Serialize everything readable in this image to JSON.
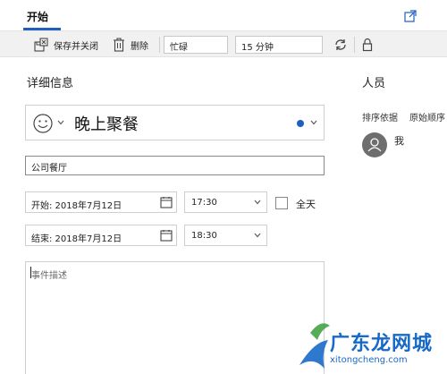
{
  "tabs": {
    "active": "开始"
  },
  "toolbar": {
    "save_close": "保存并关闭",
    "delete": "删除",
    "status": "忙碌",
    "reminder": "15 分钟"
  },
  "details": {
    "section_title": "详细信息",
    "event_title": "晚上聚餐",
    "location": "公司餐厅",
    "start_date": "开始: 2018年7月12日",
    "start_time": "17:30",
    "end_date": "结束: 2018年7月12日",
    "end_time": "18:30",
    "allday_label": "全天",
    "description_placeholder": "事件描述"
  },
  "people": {
    "section_title": "人员",
    "sort_label": "排序依据",
    "sort_value": "原始顺序",
    "person_name": "我"
  },
  "watermark": {
    "text": "广东龙网城",
    "url": "xitongcheng.com"
  },
  "colors": {
    "accent": "#1f5fbf",
    "toolbar_bg": "#f1f1f1",
    "avatar": "#6e6e6e",
    "watermark": "#1769c8"
  },
  "icons": [
    "popout-icon",
    "save-close-icon",
    "delete-icon",
    "repeat-icon",
    "lock-icon",
    "smiley-icon",
    "calendar-icon",
    "chevron-down-icon",
    "person-icon"
  ]
}
